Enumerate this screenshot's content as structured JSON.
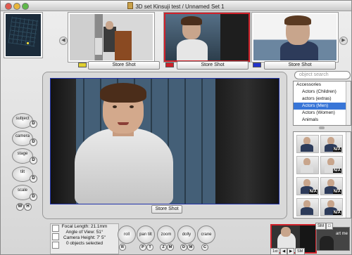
{
  "window": {
    "title": "3D set Kinsuji test / Unnamed Set 1"
  },
  "storyboard": {
    "prev_label": "◀",
    "next_label": "▶",
    "shots": [
      {
        "button": "Store Shot",
        "camera_color": "#e0d030"
      },
      {
        "button": "Store Shot",
        "camera_color": "#d0212a"
      },
      {
        "button": "Store Shot",
        "camera_color": "#2233cc"
      }
    ]
  },
  "search": {
    "placeholder": "object search"
  },
  "library": {
    "items": [
      "Accessories",
      "Actors (Children)",
      "actors (extras)",
      "Actors (Men)",
      "Actors (Women)",
      "Animals"
    ],
    "selected_index": 3
  },
  "thumbs": {
    "na_label": "N/A"
  },
  "left_controls": {
    "dials": [
      "subject",
      "camera",
      "stage",
      "tilt",
      "scale"
    ],
    "keys": [
      "D",
      "D",
      "D",
      "D",
      "D",
      "W",
      "H"
    ]
  },
  "viewport": {
    "store_button": "Store Shot"
  },
  "status": {
    "lines": [
      "Focal Length: 21.1mm",
      "Angle of View: 51°",
      "Camera Height: 7' 5\"",
      "0 objects selected"
    ]
  },
  "camera_controls": {
    "buttons": [
      "roll",
      "pan tilt",
      "zoom",
      "dolly",
      "crane"
    ],
    "keys": [
      "R",
      "P",
      "T",
      "Z",
      "M",
      "D",
      "M",
      "C"
    ]
  },
  "mini_preview": {
    "small_label": "SM",
    "label": "art me",
    "playback": [
      "1st",
      "◀",
      "▶",
      "SM"
    ]
  },
  "colors": {
    "selection": "#3875d7",
    "active_shot": "#d0212a"
  }
}
